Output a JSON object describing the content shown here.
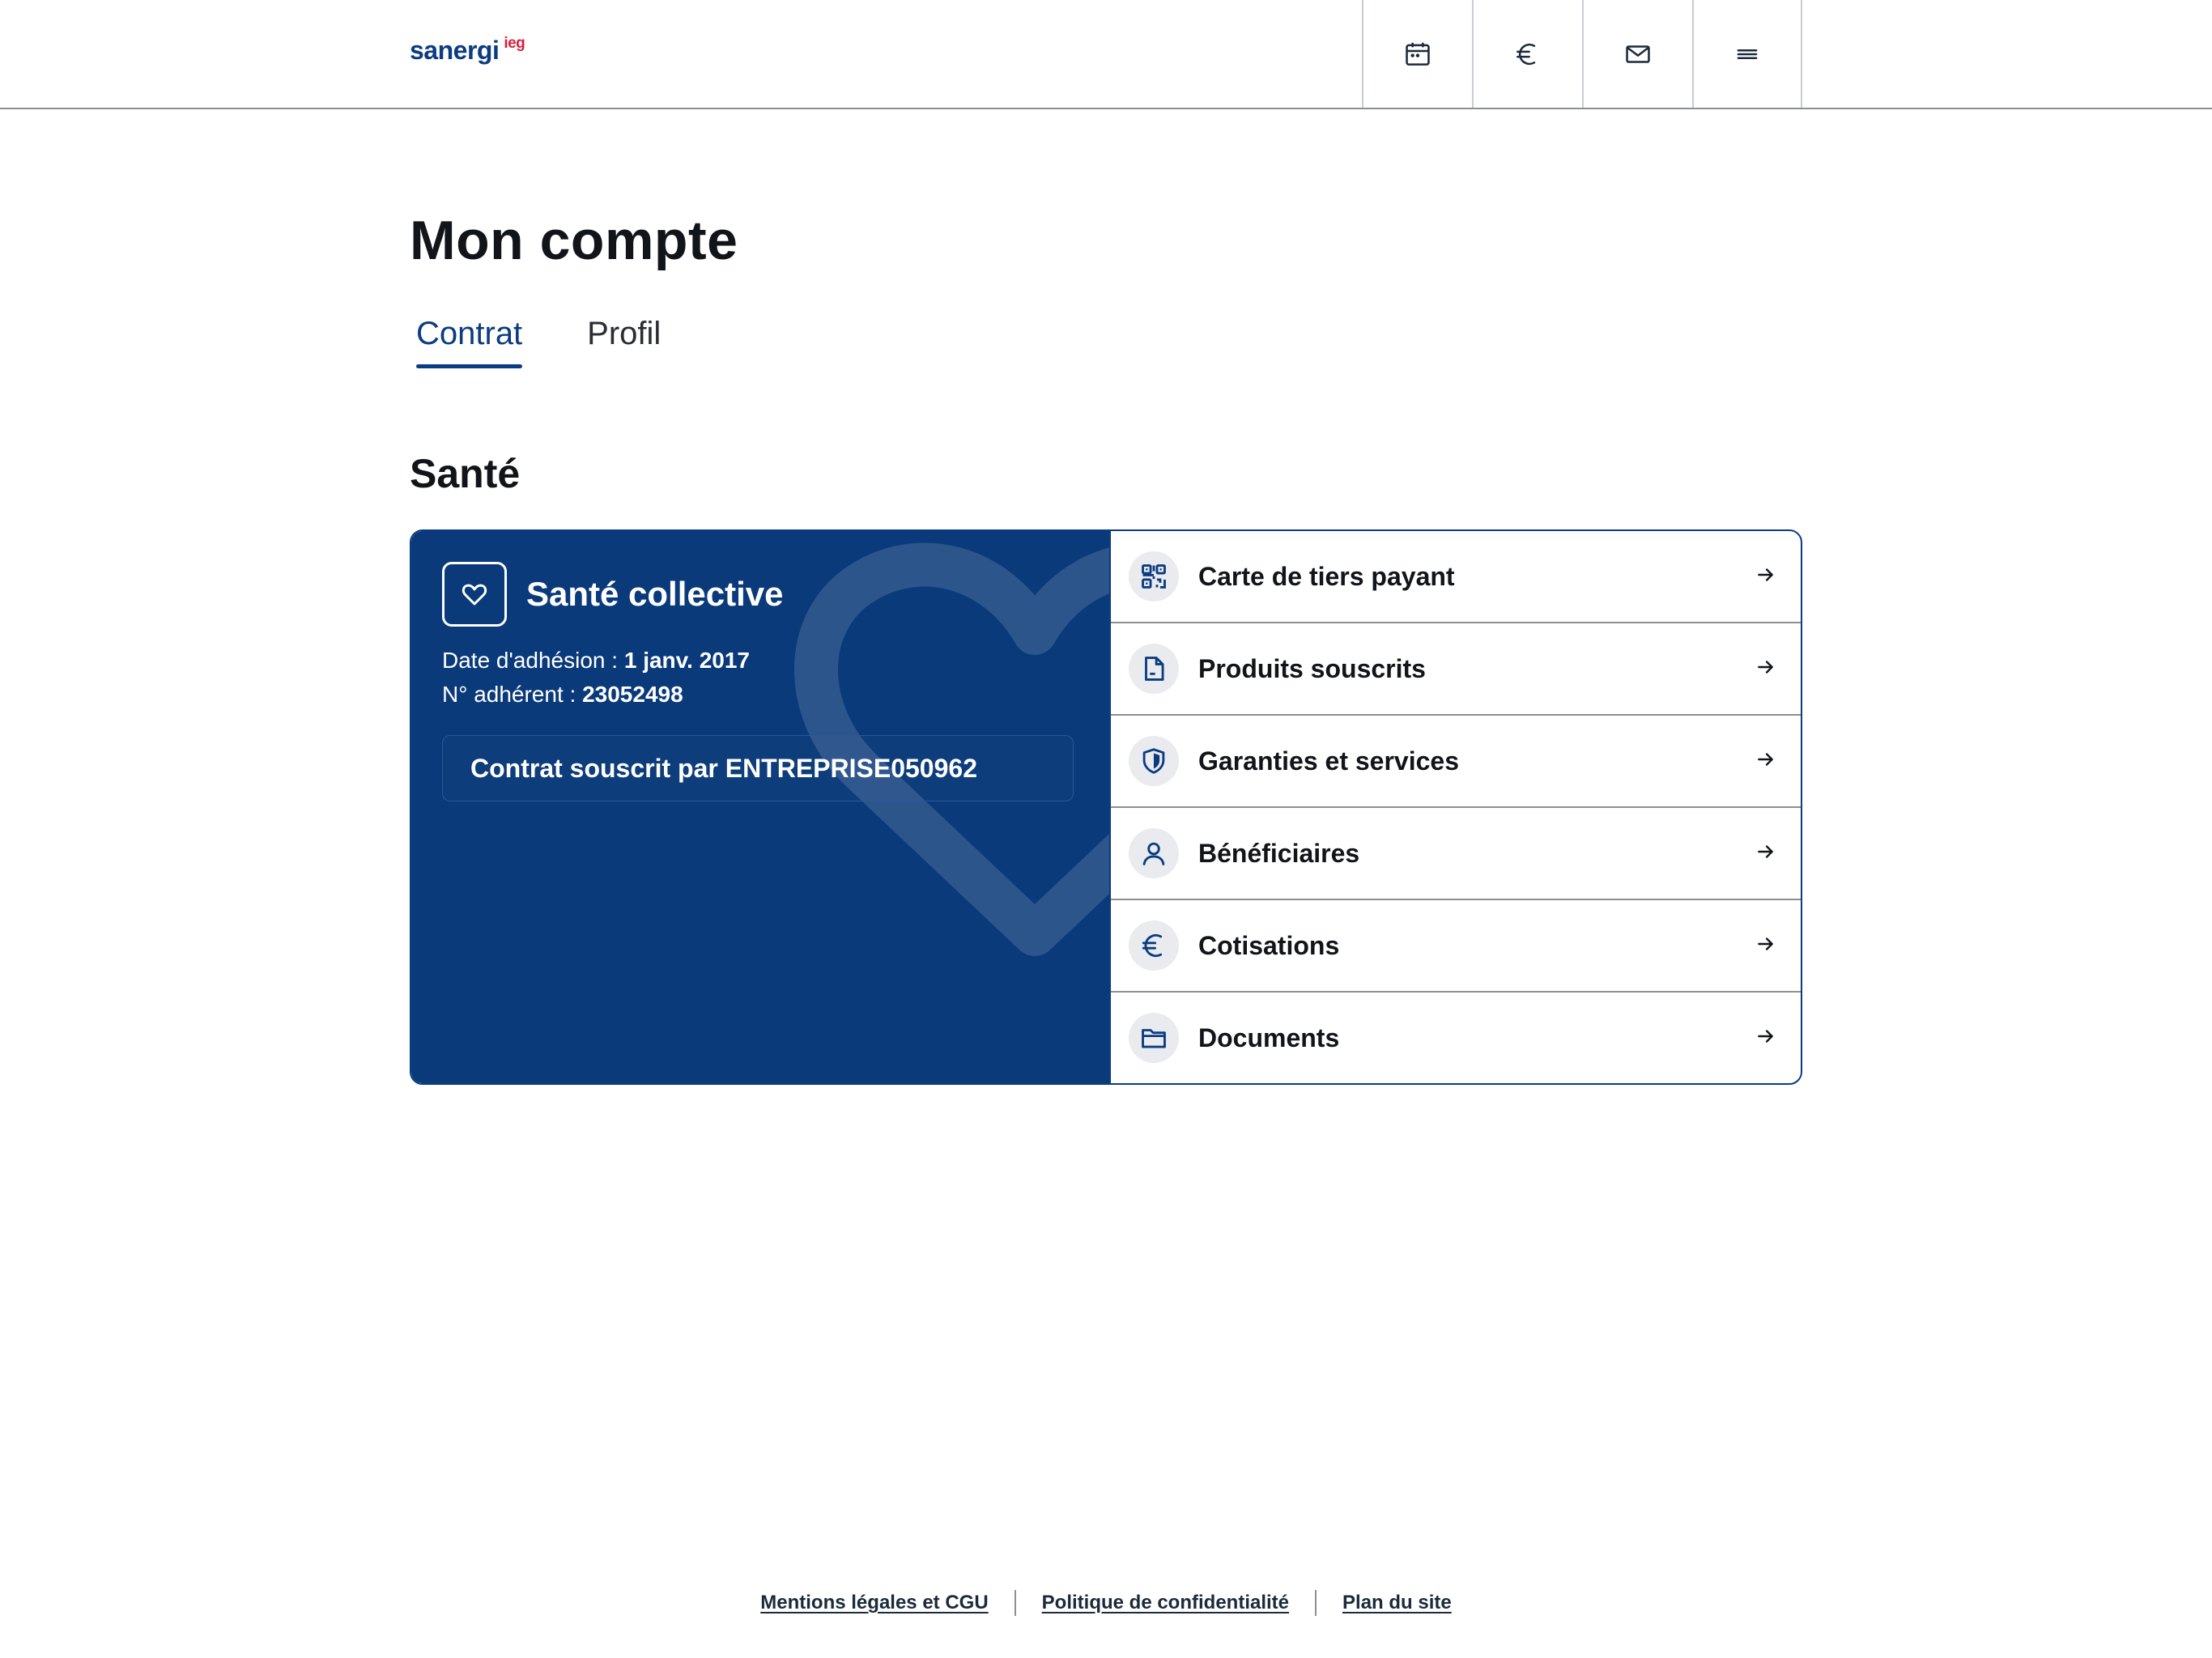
{
  "header": {
    "logo_main": "sanergi",
    "logo_sup": "ieg",
    "actions": [
      {
        "icon": "calendar-icon"
      },
      {
        "icon": "euro-icon"
      },
      {
        "icon": "mail-icon"
      },
      {
        "icon": "menu-icon"
      }
    ]
  },
  "page": {
    "title": "Mon compte",
    "tabs": [
      {
        "label": "Contrat",
        "active": true
      },
      {
        "label": "Profil",
        "active": false
      }
    ],
    "section_title": "Santé"
  },
  "contract": {
    "name": "Santé collective",
    "date_label": "Date d'adhésion : ",
    "date_value": "1 janv. 2017",
    "member_label": "N° adhérent : ",
    "member_value": "23052498",
    "subscribed_by": "Contrat souscrit par ENTREPRISE050962"
  },
  "menu": [
    {
      "label": "Carte de tiers payant",
      "icon": "qr-code-icon"
    },
    {
      "label": "Produits souscrits",
      "icon": "document-icon"
    },
    {
      "label": "Garanties et services",
      "icon": "shield-icon"
    },
    {
      "label": "Bénéficiaires",
      "icon": "user-icon"
    },
    {
      "label": "Cotisations",
      "icon": "euro-icon"
    },
    {
      "label": "Documents",
      "icon": "folder-icon"
    }
  ],
  "footer": {
    "links": [
      "Mentions légales et CGU",
      "Politique de confidentialité",
      "Plan du site"
    ]
  },
  "colors": {
    "brand": "#0b3c82",
    "card_bg": "#0a3a7a",
    "logo_accent": "#d8203b"
  }
}
